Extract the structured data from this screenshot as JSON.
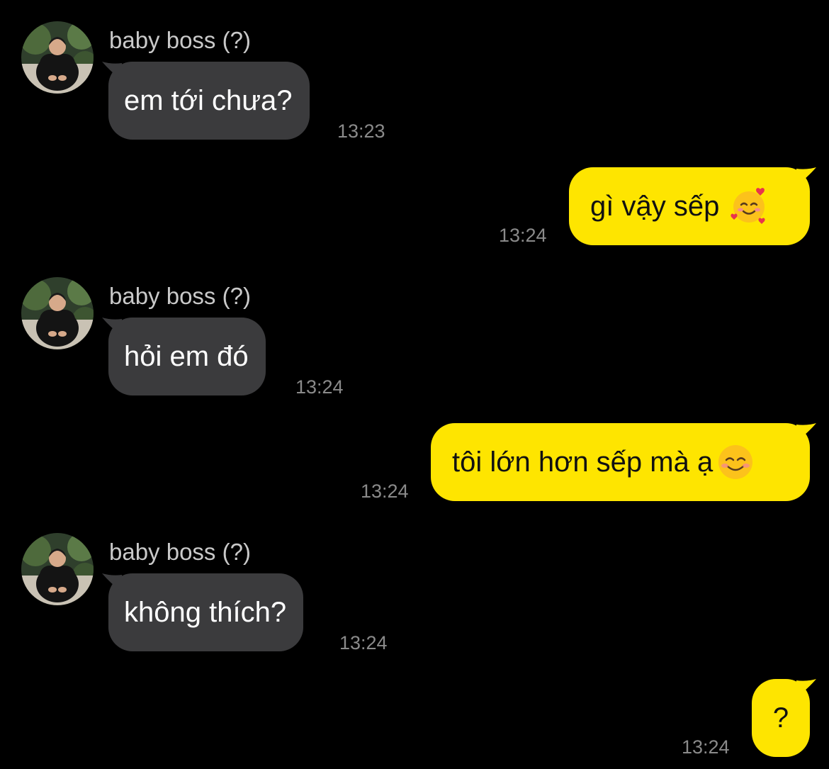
{
  "chat": {
    "sender_name": "baby boss (?)",
    "messages": [
      {
        "from": "them",
        "text": "em tới chưa?",
        "time": "13:23"
      },
      {
        "from": "me",
        "text": "gì vậy sếp",
        "emoji": "smiling-face-with-hearts-icon",
        "time": "13:24"
      },
      {
        "from": "them",
        "text": "hỏi em đó",
        "time": "13:24"
      },
      {
        "from": "me",
        "text": "tôi lớn hơn sếp mà ạ",
        "emoji": "smiling-face-icon",
        "time": "13:24"
      },
      {
        "from": "them",
        "text": "không thích?",
        "time": "13:24"
      },
      {
        "from": "me",
        "text": "?",
        "time": "13:24"
      }
    ]
  },
  "colors": {
    "background": "#000000",
    "incoming_bubble": "#3b3b3d",
    "outgoing_bubble": "#fee500",
    "timestamp": "#8a8a8a",
    "sender_name": "#c9c9c9"
  }
}
